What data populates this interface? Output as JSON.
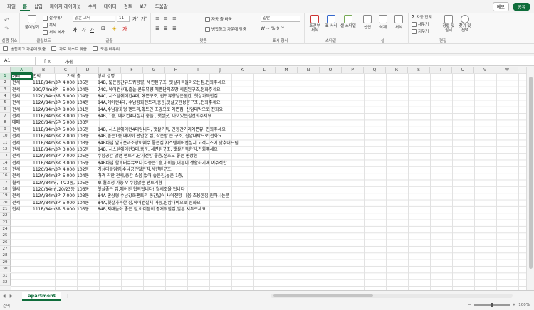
{
  "menu": {
    "tabs": [
      "파일",
      "홈",
      "삽입",
      "페이지 레이아웃",
      "수식",
      "데이터",
      "검토",
      "보기",
      "도움말"
    ],
    "active_index": 1,
    "memo_label": "메모",
    "share_label": "공유"
  },
  "ribbon": {
    "undo_group_label": "실행 취소",
    "clipboard": {
      "paste": "붙여넣기",
      "cut": "잘라내기",
      "copy": "복사",
      "format_painter": "서식 복사",
      "label": "클립보드"
    },
    "font": {
      "name": "맑은 고딕",
      "size": "11",
      "label": "글꼴"
    },
    "alignment": {
      "wrap": "자동 줄 바꿈",
      "merge": "병합하고 가운데 맞춤",
      "label": "맞춤"
    },
    "number": {
      "format": "일반",
      "label": "표시 형식"
    },
    "styles": {
      "conditional": "조건부 서식",
      "table": "표 서식",
      "cell_styles": "셀 스타일",
      "label": "스타일"
    },
    "cells": {
      "insert": "삽입",
      "delete": "삭제",
      "format": "서식",
      "label": "셀"
    },
    "editing": {
      "autosum": "자동 합계",
      "fill": "채우기",
      "clear": "지우기",
      "sort": "정렬 및 필터",
      "find": "찾기 및 선택",
      "label": "편집"
    }
  },
  "quickbar": [
    "병합하고 가운데 맞춤",
    "가로 텍스트 맞춤",
    "모든 테두리"
  ],
  "formula_bar": {
    "name_box": "A1",
    "fx": "fx",
    "content": "거래"
  },
  "columns": [
    "A",
    "B",
    "C",
    "D",
    "E",
    "F",
    "G",
    "H",
    "I",
    "J",
    "K",
    "L",
    "M",
    "N",
    "O",
    "P",
    "Q",
    "R",
    "S",
    "T",
    "U",
    "V",
    "W"
  ],
  "row_numbers": [
    "1",
    "2",
    "3",
    "4",
    "5",
    "6",
    "7",
    "8",
    "9",
    "10",
    "11",
    "12",
    "13",
    "14",
    "15",
    "16",
    "17",
    "18",
    "19",
    "20",
    "21",
    "22",
    "23",
    "24",
    "25",
    "26",
    "27",
    "28",
    "29",
    "30",
    "31",
    "32"
  ],
  "rows": [
    [
      "거래",
      "면적",
      "가격",
      "층",
      "상세 설명"
    ],
    [
      "전세",
      "111B/84m3억",
      "4,000",
      "105동",
      "84B, 넓은동간뷰드쿼향향, 세련된구조, 햇살가득들어오는집,전화주세요"
    ],
    [
      "전세",
      "99C/74m3억",
      "5,000",
      "104동",
      "74C, 에어컨4대,즐늘,콘드뷰향 예쁜단지조망 세련된구조,전화주세요"
    ],
    [
      "전세",
      "112C/84m3억",
      "5,000",
      "104동",
      "84C, 시스템에어컨4대, 예쁜구조, 퀸드뷰향남은동간, 햇살가득한집"
    ],
    [
      "전세",
      "112A/84m3억",
      "5,000",
      "104동",
      "84A,에어컨4대, 수납강화펜트리,충분,햇살굿한성향구조 ,전화주세요"
    ],
    [
      "전세",
      "112A/84m3억",
      "8,000",
      "101동",
      "84A,수납강화형 펜트리,확트인 조망으로 예쁜집, 신암대박으로 전화요"
    ],
    [
      "전세",
      "111B/84m3억",
      "3,000",
      "105동",
      "84B, 1층, 에어컨4대설치,충늘 , 햇살굿, 아이있는집전화주세요"
    ],
    [
      "매매",
      "112C/84m5억",
      "5,000",
      "103동",
      ""
    ],
    [
      "전세",
      "111B/84m3억",
      "5,000",
      "105동",
      "84B, 시스템에어컨4대입니다, 햇살가득, 긴동간거리예쁜뷰, 전화주세요"
    ],
    [
      "전세",
      "111B/84m3억",
      "2,000",
      "103동",
      "84B,높은1층,내어이 편안한 집, 작은방 큰 구조, 신암대박으로 전화요"
    ],
    [
      "전세",
      "111B/84m3억",
      "6,000",
      "103동",
      "84B타입 앞오픈과조망이예수 좋은집 시스템에어컨설치 고객니즈에 맞추어드림"
    ],
    [
      "전세",
      "111B/84m3억",
      "3,000",
      "105동",
      "84B, 시스템에어컨3대,중문, 세련된구조, 햇살가득한집,전화주세요"
    ],
    [
      "전세",
      "112A/84m3억",
      "7,000",
      "105동",
      "수납공간 많은 펜트리,단지전망 좋음,신호도 좋은 판상형"
    ],
    [
      "전세",
      "111B/84m3억",
      "3,000",
      "105동",
      "84B타입 할로터슈뮤보다 타층은1층,아이들,어른이 생활하기에 여주적합"
    ],
    [
      "전세",
      "112C/84m3억",
      "4,000",
      "102동",
      "기성데굴임림,수납공간많은집,세련된구조."
    ],
    [
      "전세",
      "112A/84m3억",
      "5,000",
      "104동",
      "가격 착한 전세,층간 소음 없어 좋은집,높은 1층,"
    ],
    [
      "월세",
      "112A/84m²,",
      "4/23동,",
      "105동",
      "보 월조정 가능 V 수납많은 팬트리형"
    ],
    [
      "월세",
      "112C/84m²,",
      "20/23동",
      "106동",
      "햇살좋은 집,에어컨 협의됩니다! 월세조율 됩니다"
    ],
    [
      "전세",
      "112A/84m3억",
      "7,000",
      "103동",
      "84A 판상형 수납강화팬트리 동간넓어 사이전망 나음 조용한집 원하시는분"
    ],
    [
      "전세",
      "112A/84m3억",
      "5,000",
      "104동",
      "84A,햇살가득한 집,에어컨설치 가능,신암대박으로 전화요"
    ],
    [
      "전세",
      "111B/84m3억",
      "5,000",
      "105동",
      "84B,지대높아 좋은 집,아이들이 즐거워할집,얼른 서두르세요"
    ]
  ],
  "sheet": {
    "tab_name": "apartment",
    "add": "+"
  },
  "status": {
    "ready": "준비",
    "zoom": "100%"
  }
}
